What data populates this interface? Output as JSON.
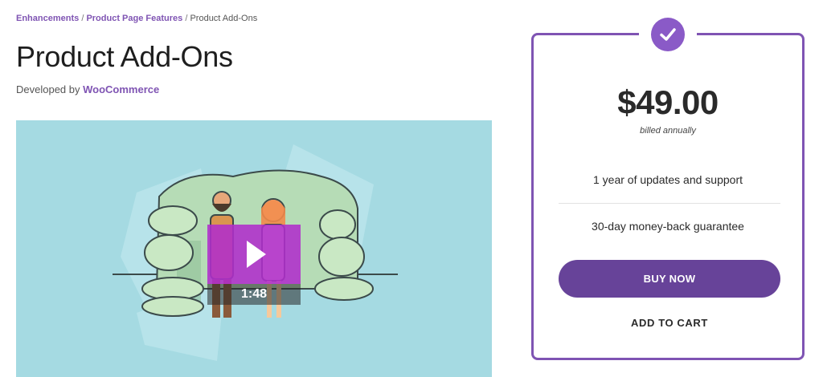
{
  "breadcrumb": {
    "items": [
      "Enhancements",
      "Product Page Features"
    ],
    "separator": "/",
    "current": "Product Add-Ons"
  },
  "product": {
    "title": "Product Add-Ons",
    "developer_prefix": "Developed by",
    "developer_name": "WooCommerce"
  },
  "video": {
    "duration": "1:48",
    "background_color": "#a5dae2",
    "play_icon": "play-icon"
  },
  "pricing": {
    "badge_icon": "checkmark-icon",
    "price": "$49.00",
    "billing": "billed annually",
    "features": [
      "1 year of updates and support",
      "30-day money-back guarantee"
    ],
    "buy_label": "BUY NOW",
    "cart_label": "ADD TO CART",
    "accent_color": "#7f54b3",
    "button_color": "#674399"
  }
}
